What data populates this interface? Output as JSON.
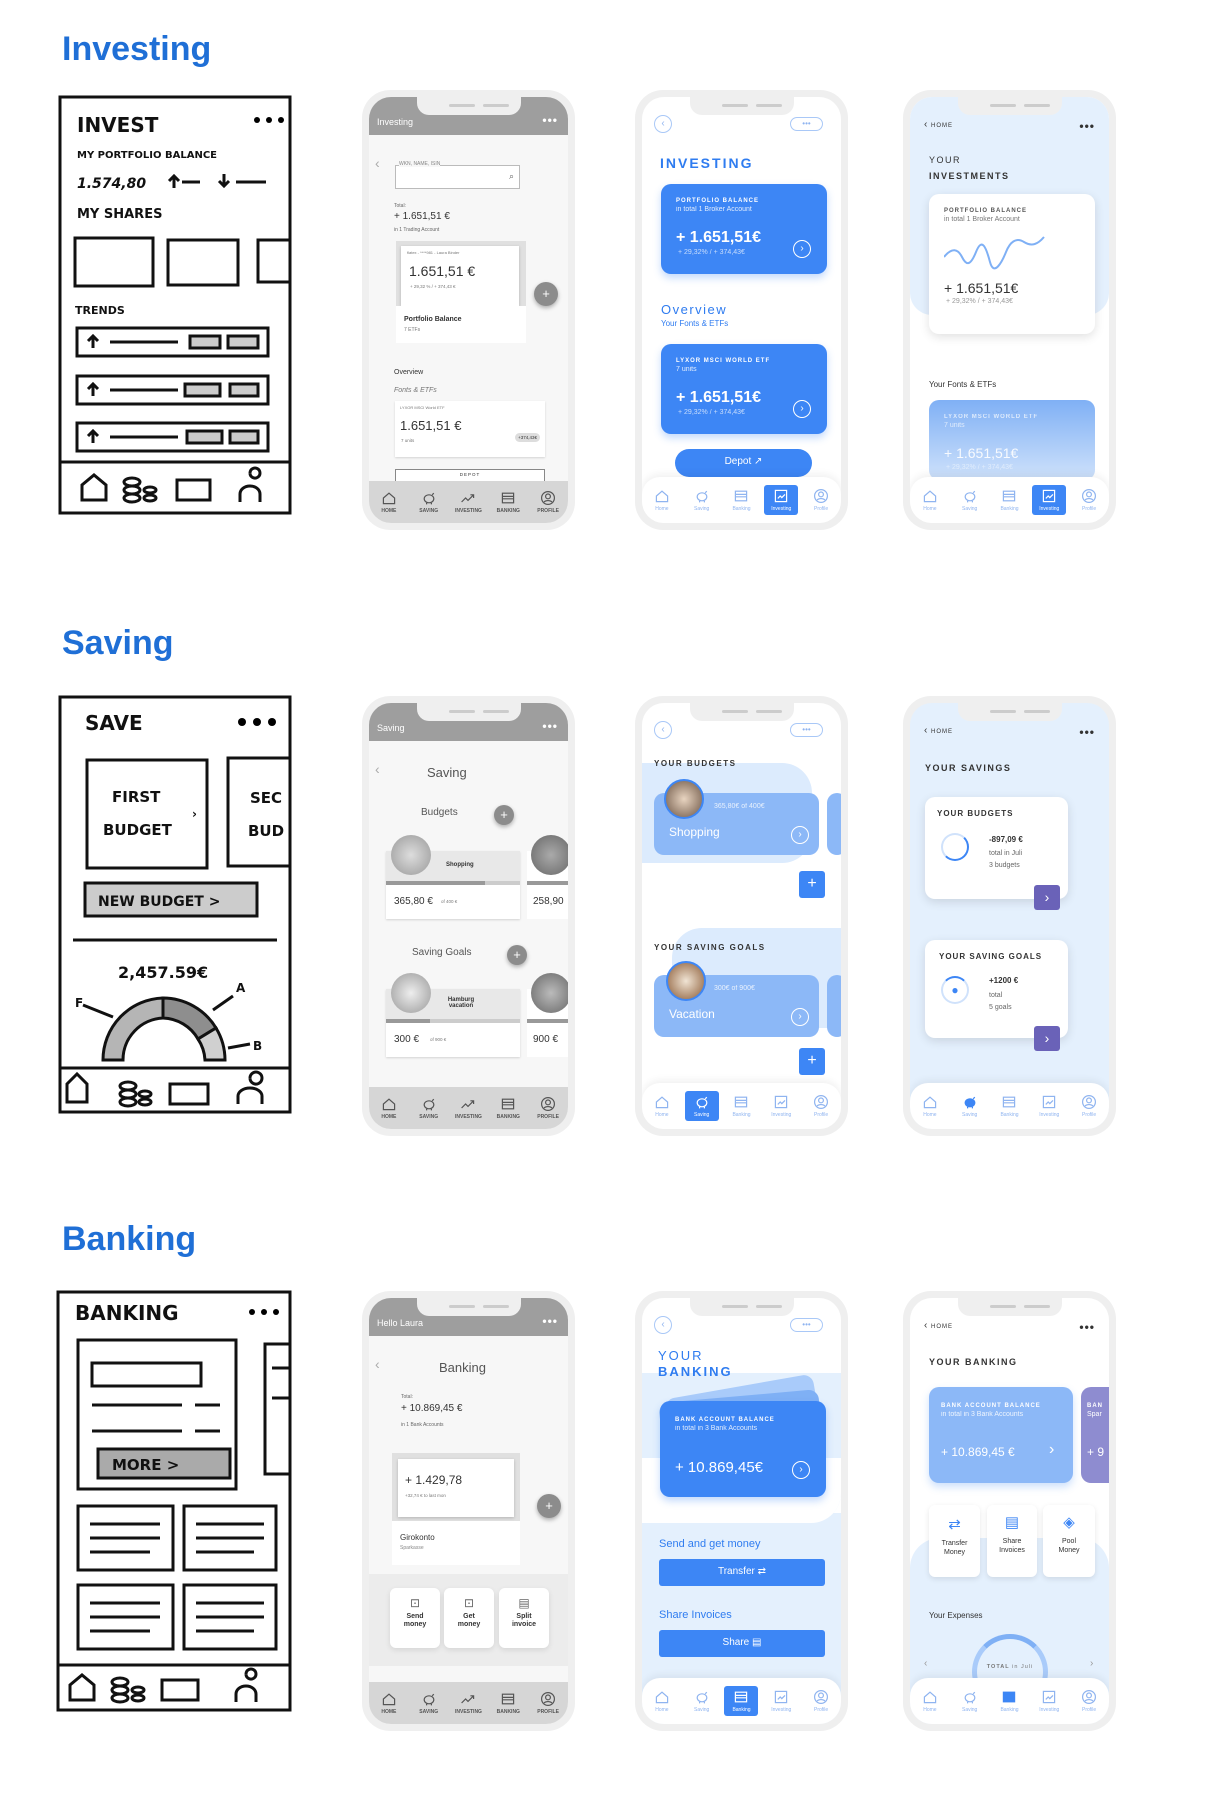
{
  "sections": {
    "investing": "Investing",
    "saving": "Saving",
    "banking": "Banking"
  },
  "colors": {
    "accent": "#3d86f5",
    "heading": "#1f6fd6",
    "light_bg": "#e4f0fd",
    "purple": "#6a62b8",
    "wire_gray": "#9e9e9e"
  },
  "nav_wire": [
    "HOME",
    "SAVING",
    "INVESTING",
    "BANKING",
    "PROFILE"
  ],
  "nav_app": [
    "Home",
    "Saving",
    "Banking",
    "Investing",
    "Profile"
  ],
  "nav_icons": {
    "wire": [
      "home-icon",
      "piggy-bank-icon",
      "trend-icon",
      "card-icon",
      "profile-icon"
    ],
    "app": [
      "home-icon",
      "piggy-bank-icon",
      "card-icon",
      "chart-icon",
      "profile-icon"
    ]
  },
  "sketches": {
    "invest": {
      "title": "INVEST",
      "portfolio_label": "MY PORTFOLIO BALANCE",
      "balance": "1.574,80",
      "shares_label": "MY SHARES",
      "trends_label": "TRENDS"
    },
    "save": {
      "title": "SAVE",
      "first_budget_1": "FIRST",
      "first_budget_2": "BUDGET",
      "second_budget_1": "SEC",
      "second_budget_2": "BUD",
      "new_budget": "NEW BUDGET >",
      "total": "2,457.59€",
      "legend": [
        "F",
        "A",
        "B"
      ]
    },
    "banking": {
      "title": "BANKING",
      "more": "MORE >"
    }
  },
  "investing": {
    "wire": {
      "header": "Investing",
      "search_placeholder": "WKN, NAME, ISIN",
      "total_label": "Total:",
      "total": "+ 1.651,51 €",
      "total_sub": "in 1 Trading Account",
      "account_line": "flatex - ****981 - Laura Binder",
      "balance": "1.651,51 €",
      "change": "+ 29,32 % / + 374,43 €",
      "card_title": "Portfolio Balance",
      "card_sub": "7 ETFs",
      "overview": "Overview",
      "overview_sub": "Fonts & ETFs",
      "etf_name": "LYXOR MSCI World ETF",
      "etf_value": "1.651,51 €",
      "etf_units": "7 units",
      "etf_badge": "+374,43€",
      "depot": "DEPOT"
    },
    "blue": {
      "title": "INVESTING",
      "card_label": "PORTFOLIO BALANCE",
      "card_sub": "in total 1 Broker Account",
      "card_value": "+ 1.651,51€",
      "card_change": "+ 29,32% / + 374,43€",
      "overview": "Overview",
      "overview_sub": "Your Fonts & ETFs",
      "etf_label": "LYXOR MSCI WORLD ETF",
      "etf_units": "7 units",
      "etf_value": "+ 1.651,51€",
      "etf_change": "+ 29,32% / + 374,43€",
      "depot": "Depot"
    },
    "light": {
      "back": "HOME",
      "title_1": "YOUR",
      "title_2": "INVESTMENTS",
      "card_label": "PORTFOLIO BALANCE",
      "card_sub": "in total 1 Broker Account",
      "card_value": "+ 1.651,51€",
      "card_change": "+ 29,32% / + 374,43€",
      "section": "Your Fonts & ETFs",
      "etf_label": "LYXOR MSCI WORLD ETF",
      "etf_units": "7 units",
      "etf_value": "+ 1.651,51€",
      "etf_change": "+ 29,32% / + 374,43€"
    }
  },
  "saving": {
    "wire": {
      "header": "Saving",
      "title": "Saving",
      "budgets": "Budgets",
      "budget_name": "Shopping",
      "budget_value": "365,80 €",
      "budget_of": "of 400 €",
      "budget2_value": "258,90",
      "goals": "Saving Goals",
      "goal_name": "Hamburg vacation",
      "goal_value": "300 €",
      "goal_of": "of 900 €",
      "goal2_value": "900 €"
    },
    "blue": {
      "budgets_title": "YOUR BUDGETS",
      "budget_progress": "365,80€ of 400€",
      "budget_name": "Shopping",
      "goals_title": "YOUR SAVING GOALS",
      "goal_progress": "300€ of 900€",
      "goal_name": "Vacation"
    },
    "light": {
      "back": "HOME",
      "title": "YOUR SAVINGS",
      "budgets_title": "YOUR BUDGETS",
      "budgets_value": "-897,09 €",
      "budgets_sub1": "total in Juli",
      "budgets_sub2": "3 budgets",
      "goals_title": "YOUR SAVING GOALS",
      "goals_value": "+1200 €",
      "goals_sub1": "total",
      "goals_sub2": "5 goals"
    }
  },
  "banking": {
    "wire": {
      "header": "Hello Laura",
      "title": "Banking",
      "total_label": "Total:",
      "total": "+ 10.869,45 €",
      "total_sub": "in 1 Bank Accounts",
      "account_value": "+ 1.429,78",
      "account_change": "+32,74 € to last mon",
      "account_name": "Girokonto",
      "account_bank": "Sparkasse",
      "actions": [
        "Send money",
        "Get money",
        "Split invoice"
      ]
    },
    "blue": {
      "title_1": "YOUR",
      "title_2": "BANKING",
      "card_label": "BANK ACCOUNT BALANCE",
      "card_sub": "in total in 3 Bank Accounts",
      "card_value": "+ 10.869,45€",
      "send_title": "Send and get money",
      "transfer": "Transfer",
      "share_title": "Share Invoices",
      "share": "Share"
    },
    "light": {
      "back": "HOME",
      "title": "YOUR BANKING",
      "card_label": "BANK ACCOUNT BALANCE",
      "card_sub": "in total in 3 Bank Accounts",
      "card_value": "+ 10.869,45 €",
      "card2_label": "BAN",
      "card2_sub": "Spar",
      "card2_value": "+ 9",
      "actions": [
        "Transfer Money",
        "Share Invoices",
        "Pool Money"
      ],
      "expenses": "Your Expenses",
      "gauge_label": "TOTAL",
      "gauge_sub": "in Juli"
    }
  }
}
